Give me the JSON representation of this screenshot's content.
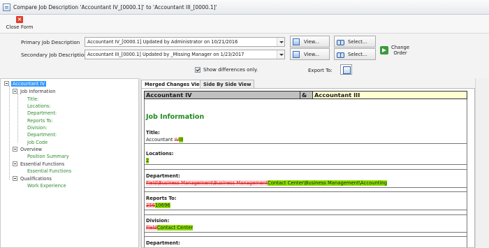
{
  "window": {
    "title": "Compare Job Description 'Accountant IV_[0000.1]' to 'Accountant III_[0000.1]'"
  },
  "toolbar": {
    "close_label": "Close Form"
  },
  "form": {
    "primary_label": "Primary Job Description",
    "primary_value": "Accountant IV_[0000.1] Updated by Administrator on 10/21/2016",
    "secondary_label": "Secondary Job Description",
    "secondary_value": "Accountant III_[0000.1] Updated by _Missing Manager on 1/23/2017",
    "view_label": "View...",
    "select_label": "Select...",
    "change_order_label": "Change Order",
    "show_diff_label": "Show differences only.",
    "show_diff_checked": true,
    "export_label": "Export To:"
  },
  "tree": {
    "root": "Accountant IV",
    "groups": [
      {
        "label": "Job Information",
        "items": [
          "Title:",
          "Locations:",
          "Department:",
          "Reports To:",
          "Division:",
          "Department:",
          "Job Code"
        ]
      },
      {
        "label": "Overview",
        "items": [
          "Position Summary"
        ]
      },
      {
        "label": "Essential Functions",
        "items": [
          "Essential Functions"
        ]
      },
      {
        "label": "Qualifications",
        "items": [
          "Work Experience"
        ]
      }
    ]
  },
  "tabs": [
    {
      "label": "Merged Changes View",
      "active": true
    },
    {
      "label": "Side By Side View",
      "active": false
    }
  ],
  "doc": {
    "left_title": "Accountant IV",
    "amp": "&",
    "right_title": "Accountant III",
    "section_title": "Job Information",
    "title_label": "Title:",
    "title_base": "Accountant ",
    "title_del": "IV",
    "title_ins": "III",
    "locations_label": "Locations:",
    "locations_ins": "2",
    "department_label": "Department:",
    "department_del": "Field\\Business Management\\Business Management",
    "department_ins": "Contact Center\\Business Management\\Accounting",
    "reports_label": "Reports To:",
    "reports_del": "356",
    "reports_ins": "10696",
    "division_label": "Division:",
    "division_del": "Field",
    "division_ins": "Contact Center",
    "department2_label": "Department:"
  },
  "colors": {
    "added": "#8ee000",
    "removed": "#d21c1c",
    "section": "#1f8a1f",
    "selection": "#3399ff"
  }
}
